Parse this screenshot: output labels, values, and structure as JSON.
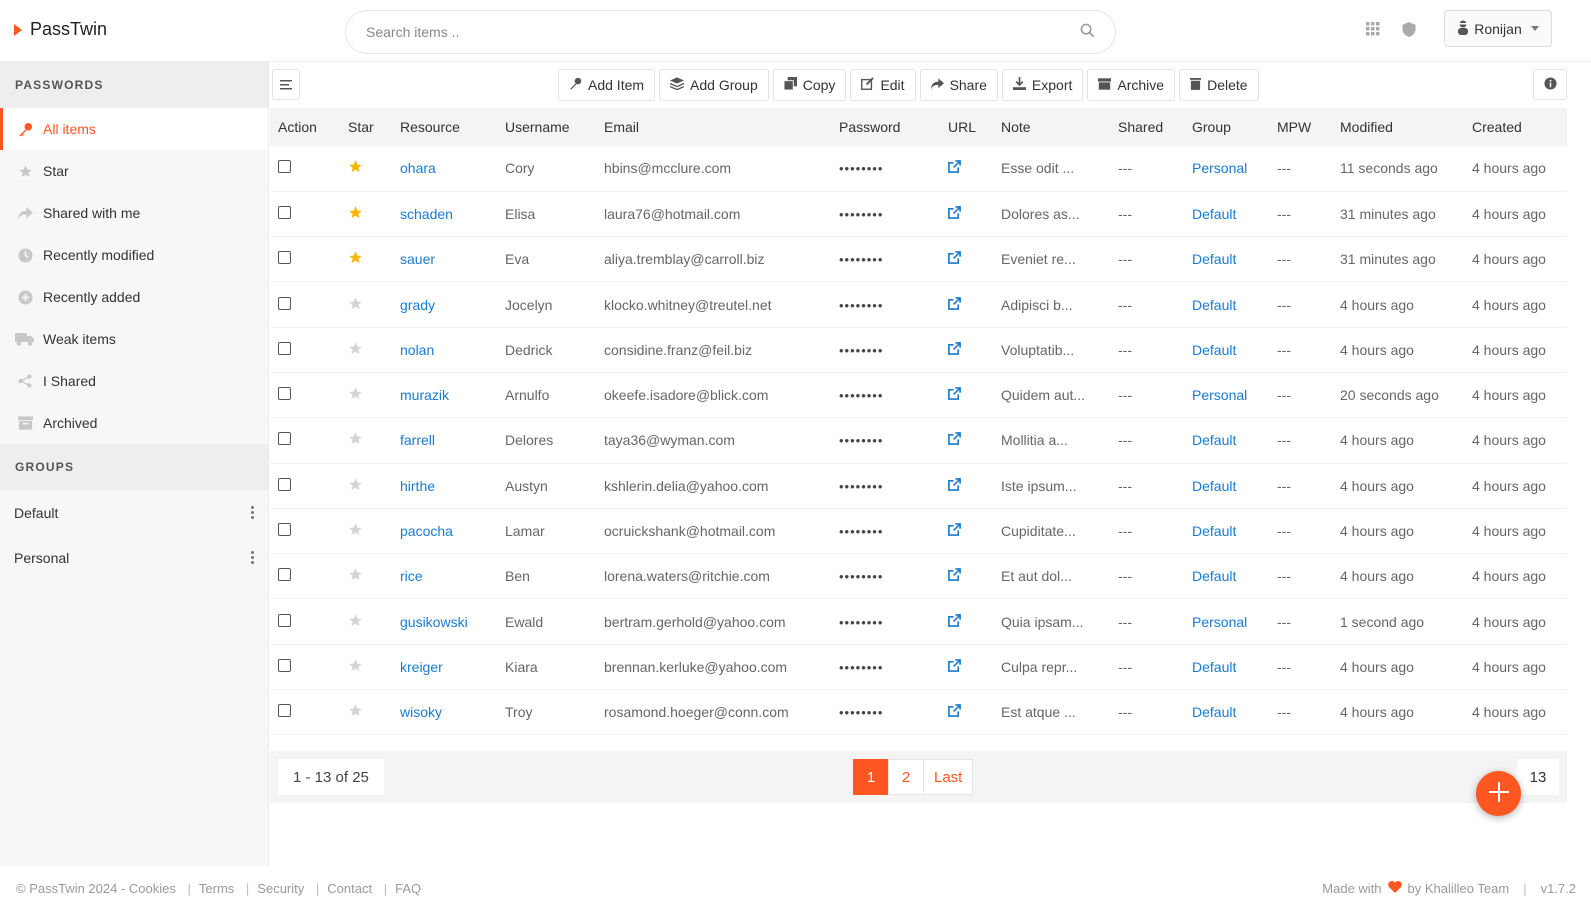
{
  "app": {
    "name": "PassTwin"
  },
  "search": {
    "placeholder": "Search items .."
  },
  "user": {
    "name": "Ronijan"
  },
  "sidebar": {
    "passwords_heading": "PASSWORDS",
    "items": [
      {
        "label": "All items",
        "icon": "key-icon"
      },
      {
        "label": "Star",
        "icon": "star-icon"
      },
      {
        "label": "Shared with me",
        "icon": "share-icon"
      },
      {
        "label": "Recently modified",
        "icon": "clock-icon"
      },
      {
        "label": "Recently added",
        "icon": "plus-circle-icon"
      },
      {
        "label": "Weak items",
        "icon": "truck-icon"
      },
      {
        "label": "I Shared",
        "icon": "share-nodes-icon"
      },
      {
        "label": "Archived",
        "icon": "archive-icon"
      }
    ],
    "groups_heading": "GROUPS",
    "groups": [
      {
        "label": "Default"
      },
      {
        "label": "Personal"
      }
    ]
  },
  "toolbar": {
    "buttons": [
      {
        "label": "Add Item",
        "icon": "key-icon"
      },
      {
        "label": "Add Group",
        "icon": "layers-icon"
      },
      {
        "label": "Copy",
        "icon": "copy-icon"
      },
      {
        "label": "Edit",
        "icon": "edit-icon"
      },
      {
        "label": "Share",
        "icon": "share-icon"
      },
      {
        "label": "Export",
        "icon": "download-icon"
      },
      {
        "label": "Archive",
        "icon": "archive-icon"
      },
      {
        "label": "Delete",
        "icon": "trash-icon"
      }
    ]
  },
  "table": {
    "headers": [
      "Action",
      "Star",
      "Resource",
      "Username",
      "Email",
      "Password",
      "URL",
      "Note",
      "Shared",
      "Group",
      "MPW",
      "Modified",
      "Created"
    ],
    "rows": [
      {
        "starred": true,
        "resource": "ohara",
        "username": "Cory",
        "email": "hbins@mcclure.com",
        "password": "••••••••",
        "note": "Esse odit ...",
        "shared": "---",
        "group": "Personal",
        "mpw": "---",
        "modified": "11 seconds ago",
        "created": "4 hours ago"
      },
      {
        "starred": true,
        "resource": "schaden",
        "username": "Elisa",
        "email": "laura76@hotmail.com",
        "password": "••••••••",
        "note": "Dolores as...",
        "shared": "---",
        "group": "Default",
        "mpw": "---",
        "modified": "31 minutes ago",
        "created": "4 hours ago"
      },
      {
        "starred": true,
        "resource": "sauer",
        "username": "Eva",
        "email": "aliya.tremblay@carroll.biz",
        "password": "••••••••",
        "note": "Eveniet re...",
        "shared": "---",
        "group": "Default",
        "mpw": "---",
        "modified": "31 minutes ago",
        "created": "4 hours ago"
      },
      {
        "starred": false,
        "resource": "grady",
        "username": "Jocelyn",
        "email": "klocko.whitney@treutel.net",
        "password": "••••••••",
        "note": "Adipisci b...",
        "shared": "---",
        "group": "Default",
        "mpw": "---",
        "modified": "4 hours ago",
        "created": "4 hours ago"
      },
      {
        "starred": false,
        "resource": "nolan",
        "username": "Dedrick",
        "email": "considine.franz@feil.biz",
        "password": "••••••••",
        "note": "Voluptatib...",
        "shared": "---",
        "group": "Default",
        "mpw": "---",
        "modified": "4 hours ago",
        "created": "4 hours ago"
      },
      {
        "starred": false,
        "resource": "murazik",
        "username": "Arnulfo",
        "email": "okeefe.isadore@blick.com",
        "password": "••••••••",
        "note": "Quidem aut...",
        "shared": "---",
        "group": "Personal",
        "mpw": "---",
        "modified": "20 seconds ago",
        "created": "4 hours ago"
      },
      {
        "starred": false,
        "resource": "farrell",
        "username": "Delores",
        "email": "taya36@wyman.com",
        "password": "••••••••",
        "note": "Mollitia a...",
        "shared": "---",
        "group": "Default",
        "mpw": "---",
        "modified": "4 hours ago",
        "created": "4 hours ago"
      },
      {
        "starred": false,
        "resource": "hirthe",
        "username": "Austyn",
        "email": "kshlerin.delia@yahoo.com",
        "password": "••••••••",
        "note": "Iste ipsum...",
        "shared": "---",
        "group": "Default",
        "mpw": "---",
        "modified": "4 hours ago",
        "created": "4 hours ago"
      },
      {
        "starred": false,
        "resource": "pacocha",
        "username": "Lamar",
        "email": "ocruickshank@hotmail.com",
        "password": "••••••••",
        "note": "Cupiditate...",
        "shared": "---",
        "group": "Default",
        "mpw": "---",
        "modified": "4 hours ago",
        "created": "4 hours ago"
      },
      {
        "starred": false,
        "resource": "rice",
        "username": "Ben",
        "email": "lorena.waters@ritchie.com",
        "password": "••••••••",
        "note": "Et aut dol...",
        "shared": "---",
        "group": "Default",
        "mpw": "---",
        "modified": "4 hours ago",
        "created": "4 hours ago"
      },
      {
        "starred": false,
        "resource": "gusikowski",
        "username": "Ewald",
        "email": "bertram.gerhold@yahoo.com",
        "password": "••••••••",
        "note": "Quia ipsam...",
        "shared": "---",
        "group": "Personal",
        "mpw": "---",
        "modified": "1 second ago",
        "created": "4 hours ago"
      },
      {
        "starred": false,
        "resource": "kreiger",
        "username": "Kiara",
        "email": "brennan.kerluke@yahoo.com",
        "password": "••••••••",
        "note": "Culpa repr...",
        "shared": "---",
        "group": "Default",
        "mpw": "---",
        "modified": "4 hours ago",
        "created": "4 hours ago"
      },
      {
        "starred": false,
        "resource": "wisoky",
        "username": "Troy",
        "email": "rosamond.hoeger@conn.com",
        "password": "••••••••",
        "note": "Est atque ...",
        "shared": "---",
        "group": "Default",
        "mpw": "---",
        "modified": "4 hours ago",
        "created": "4 hours ago"
      }
    ]
  },
  "pagination": {
    "summary": "1 - 13 of 25",
    "pages": [
      "1",
      "2"
    ],
    "last_label": "Last",
    "current": "1",
    "per_page": "13"
  },
  "footer": {
    "copyright": "© PassTwin 2024 - Cookies",
    "links": [
      "Terms",
      "Security",
      "Contact",
      "FAQ"
    ],
    "made_with": "Made with",
    "by": "by Khalilleo Team",
    "version": "v1.7.2"
  },
  "colors": {
    "accent": "#ff5722",
    "link": "#1a7bd1",
    "star": "#f7b500"
  }
}
